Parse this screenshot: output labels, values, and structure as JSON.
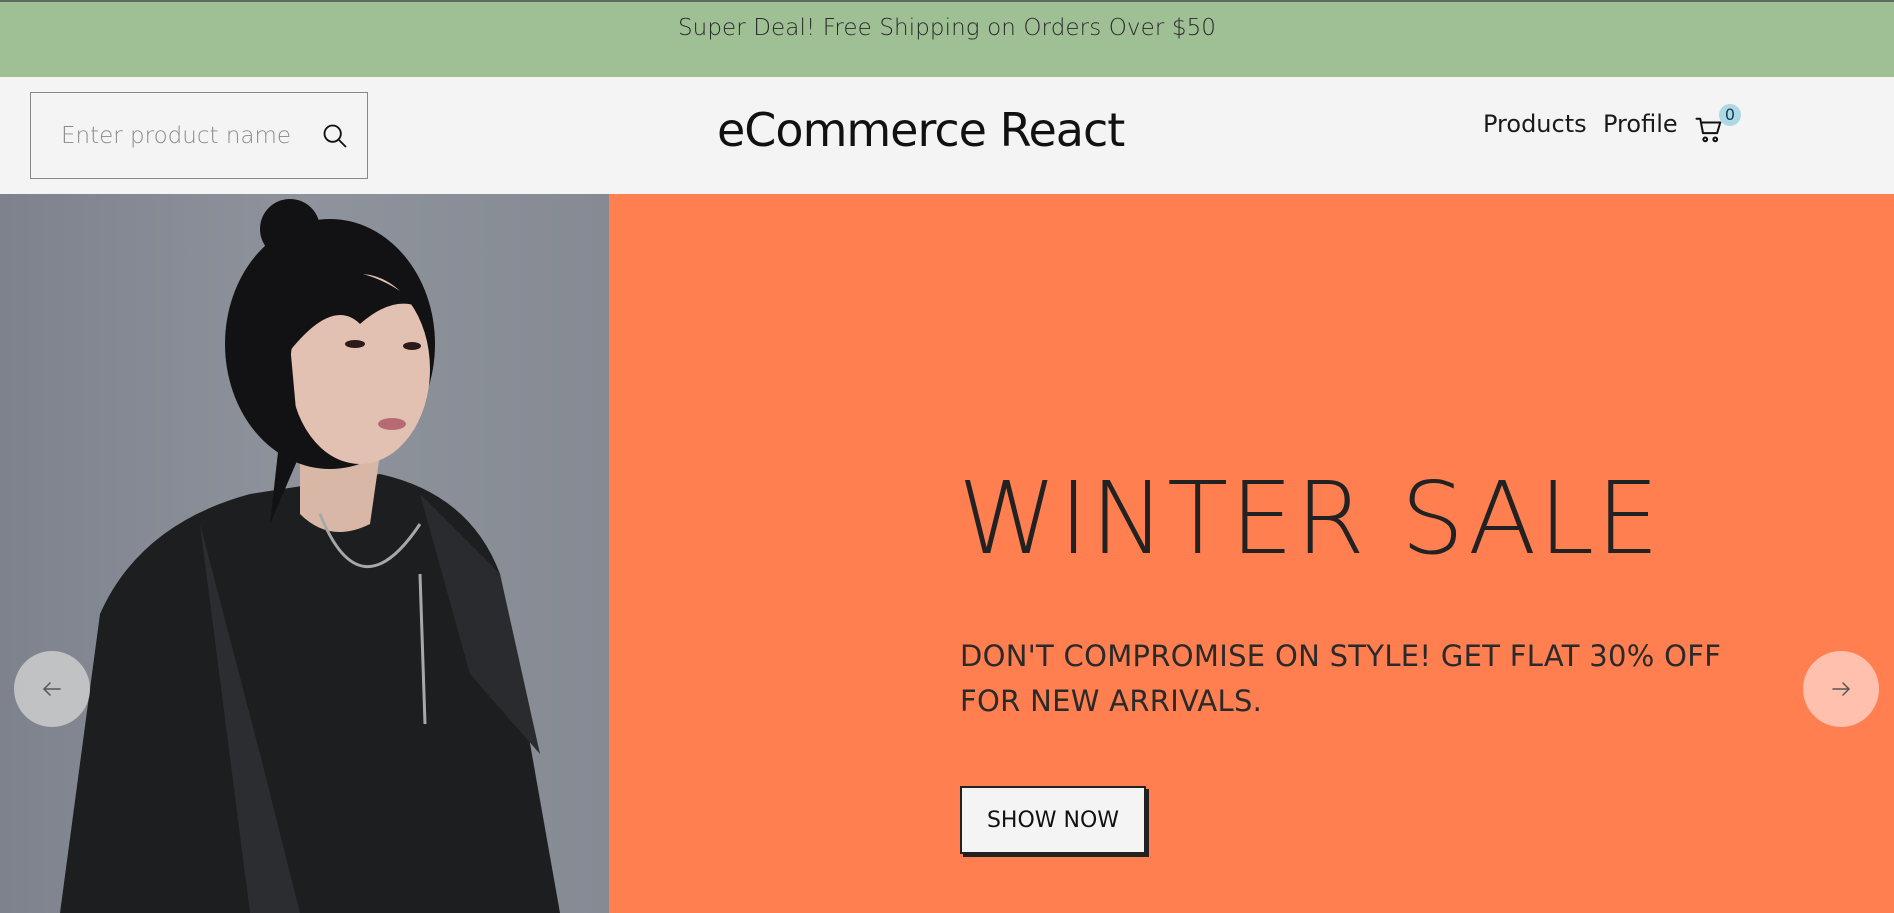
{
  "announcement": {
    "text": "Super Deal! Free Shipping on Orders Over $50"
  },
  "search": {
    "placeholder": "Enter product name",
    "icon": "search-icon"
  },
  "logo": {
    "text": "eCommerce React"
  },
  "nav": {
    "products_label": "Products",
    "profile_label": "Profile",
    "cart_icon": "shopping-cart-icon",
    "cart_count": "0"
  },
  "hero": {
    "title": "WINTER SALE",
    "description": "DON'T COMPROMISE ON STYLE! GET FLAT 30% OFF FOR NEW ARRIVALS.",
    "button_label": "SHOW NOW",
    "left_arrow_icon": "arrow-left-icon",
    "right_arrow_icon": "arrow-right-icon",
    "image_alt": "model-photo"
  },
  "colors": {
    "announcement_bg": "#9fc095",
    "header_bg": "#f4f4f4",
    "hero_bg": "#ff7f50",
    "cart_badge_bg": "#add8e6"
  }
}
